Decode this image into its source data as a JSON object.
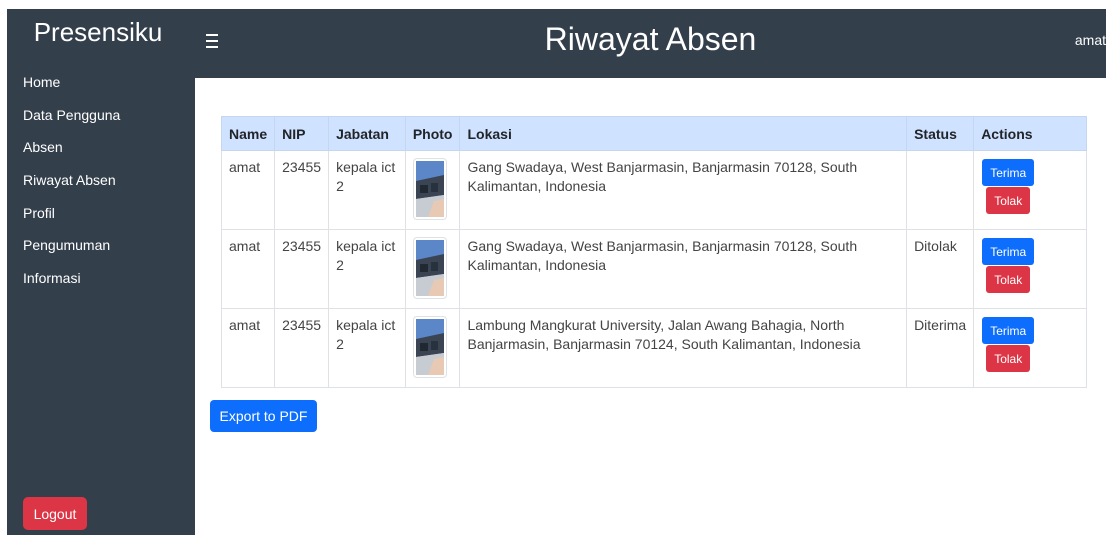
{
  "sidebar": {
    "brand": "Presensiku",
    "items": [
      {
        "label": "Home"
      },
      {
        "label": "Data Pengguna"
      },
      {
        "label": "Absen"
      },
      {
        "label": "Riwayat Absen"
      },
      {
        "label": "Profil"
      },
      {
        "label": "Pengumuman"
      },
      {
        "label": "Informasi"
      }
    ],
    "logout_label": "Logout"
  },
  "header": {
    "menu_icon": "hamburger-icon",
    "title": "Riwayat Absen",
    "user": "amat"
  },
  "table": {
    "columns": [
      "Name",
      "NIP",
      "Jabatan",
      "Photo",
      "Lokasi",
      "Status",
      "Actions"
    ],
    "rows": [
      {
        "name": "amat",
        "nip": "23455",
        "jabatan": "kepala ict 2",
        "photo_icon": "photo-thumbnail",
        "lokasi": "Gang Swadaya, West Banjarmasin, Banjarmasin 70128, South Kalimantan, Indonesia",
        "status": "",
        "accept_label": "Terima",
        "reject_label": "Tolak"
      },
      {
        "name": "amat",
        "nip": "23455",
        "jabatan": "kepala ict 2",
        "photo_icon": "photo-thumbnail",
        "lokasi": "Gang Swadaya, West Banjarmasin, Banjarmasin 70128, South Kalimantan, Indonesia",
        "status": "Ditolak",
        "accept_label": "Terima",
        "reject_label": "Tolak"
      },
      {
        "name": "amat",
        "nip": "23455",
        "jabatan": "kepala ict 2",
        "photo_icon": "photo-thumbnail",
        "lokasi": "Lambung Mangkurat University, Jalan Awang Bahagia, North Banjarmasin, Banjarmasin 70124, South Kalimantan, Indonesia",
        "status": "Diterima",
        "accept_label": "Terima",
        "reject_label": "Tolak"
      }
    ]
  },
  "export_label": "Export to PDF",
  "colors": {
    "sidebar_bg": "#343f4c",
    "primary": "#0d6efd",
    "danger": "#dc3545",
    "table_header_bg": "#cfe2ff"
  }
}
